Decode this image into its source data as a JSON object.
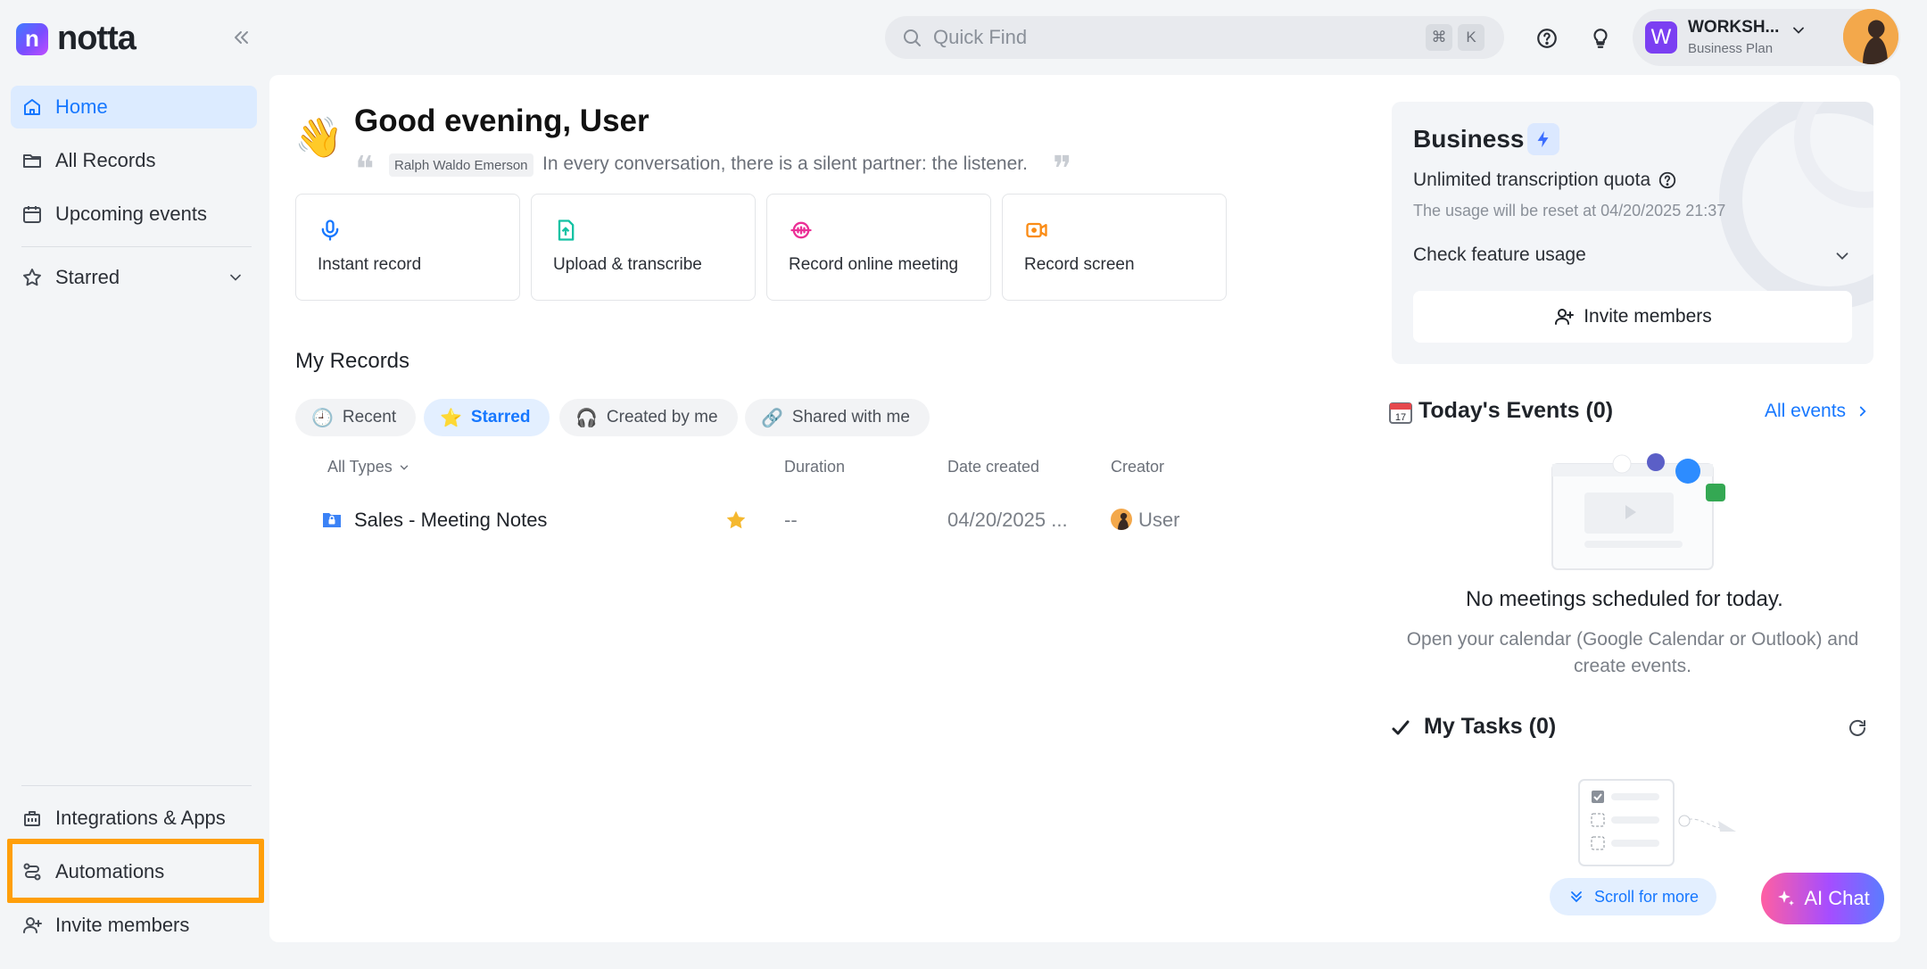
{
  "app": {
    "name": "notta"
  },
  "sidebar": {
    "nav": [
      {
        "label": "Home",
        "icon": "home-icon",
        "active": true
      },
      {
        "label": "All Records",
        "icon": "folder-icon"
      },
      {
        "label": "Upcoming events",
        "icon": "calendar-icon"
      }
    ],
    "starred_label": "Starred",
    "bottom": [
      {
        "label": "Integrations & Apps",
        "icon": "apps-icon"
      },
      {
        "label": "Automations",
        "icon": "automations-icon"
      },
      {
        "label": "Invite members",
        "icon": "add-user-icon"
      }
    ],
    "highlight_color": "#ff9f0a"
  },
  "topbar": {
    "search_placeholder": "Quick Find",
    "shortcut_keys": [
      "⌘",
      "K"
    ],
    "workspace": {
      "initial": "W",
      "name": "WORKSH...",
      "plan": "Business Plan"
    }
  },
  "home": {
    "greeting": "Good evening, User",
    "quote_author": "Ralph Waldo Emerson",
    "quote_text": "In every conversation, there is a silent partner: the listener.",
    "actions": [
      {
        "label": "Instant record",
        "icon": "microphone-icon",
        "color": "#1677ff"
      },
      {
        "label": "Upload & transcribe",
        "icon": "upload-file-icon",
        "color": "#13c2a3"
      },
      {
        "label": "Record online meeting",
        "icon": "meeting-icon",
        "color": "#eb2f96"
      },
      {
        "label": "Record screen",
        "icon": "screen-record-icon",
        "color": "#fa8c16"
      }
    ],
    "records_title": "My Records",
    "tabs": [
      {
        "label": "Recent",
        "icon": "🕘"
      },
      {
        "label": "Starred",
        "icon": "⭐",
        "active": true
      },
      {
        "label": "Created by me",
        "icon": "🎧"
      },
      {
        "label": "Shared with me",
        "icon": "🔗"
      }
    ],
    "columns": {
      "type_filter": "All Types",
      "duration": "Duration",
      "date": "Date created",
      "creator": "Creator"
    },
    "records": [
      {
        "name": "Sales - Meeting Notes",
        "starred": true,
        "duration": "--",
        "date": "04/20/2025 ...",
        "creator": "User"
      }
    ]
  },
  "plan_card": {
    "title": "Business",
    "quota": "Unlimited transcription quota",
    "reset": "The usage will be reset at 04/20/2025 21:37",
    "check_usage": "Check feature usage",
    "invite": "Invite members"
  },
  "events": {
    "title": "Today's Events (0)",
    "link": "All events",
    "empty_title": "No meetings scheduled for today.",
    "empty_desc": "Open your calendar (Google Calendar or Outlook) and create events."
  },
  "tasks": {
    "title": "My Tasks (0)",
    "scroll_hint": "Scroll for more"
  },
  "ai_chat": {
    "label": "AI Chat"
  },
  "colors": {
    "accent": "#1677ff",
    "active_nav_bg": "#dcebff"
  }
}
